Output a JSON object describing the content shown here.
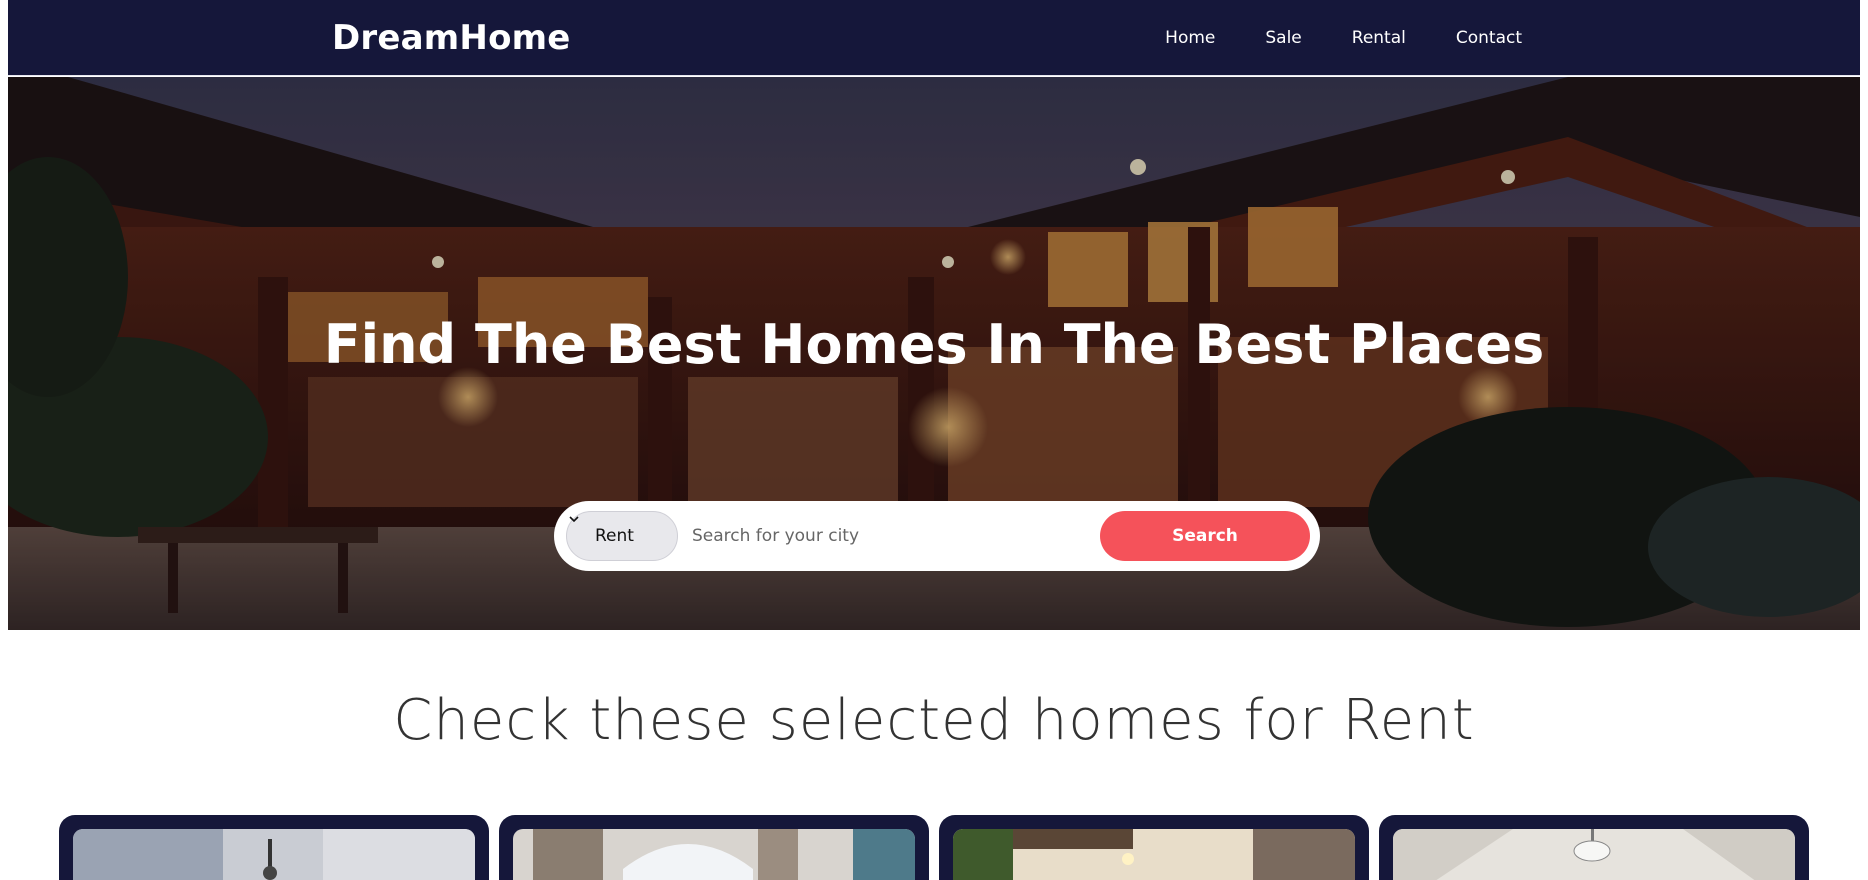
{
  "header": {
    "brand": "DreamHome",
    "nav": [
      {
        "label": "Home"
      },
      {
        "label": "Sale"
      },
      {
        "label": "Rental"
      },
      {
        "label": "Contact"
      }
    ]
  },
  "hero": {
    "title": "Find The Best Homes In The Best Places"
  },
  "search": {
    "type_selected": "Rent",
    "placeholder": "Search for your city",
    "button_label": "Search"
  },
  "section": {
    "heading": "Check these selected homes for Rent"
  },
  "cards": [
    {
      "image": "living-room-photo"
    },
    {
      "image": "arched-window-room-photo"
    },
    {
      "image": "kitchen-plants-photo"
    },
    {
      "image": "empty-room-light-fixture-photo"
    }
  ],
  "colors": {
    "navbar_bg": "#15173a",
    "accent": "#f5525a",
    "card_bg": "#15173a"
  }
}
